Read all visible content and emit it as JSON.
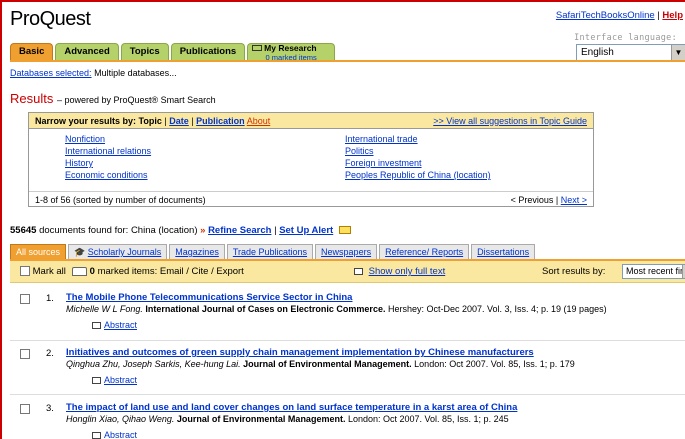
{
  "header": {
    "logo": "ProQuest",
    "link_safari": "SafariTechBooksOnline",
    "link_sep": "|",
    "link_help": "Help",
    "interface_label": "Interface language:",
    "language": "English"
  },
  "tabs": [
    {
      "label": "Basic"
    },
    {
      "label": "Advanced"
    },
    {
      "label": "Topics"
    },
    {
      "label": "Publications"
    }
  ],
  "research_tab": {
    "label": "My Research",
    "sub": "0 marked items"
  },
  "databases": {
    "label": "Databases selected:",
    "value": "Multiple databases..."
  },
  "results_title": {
    "title": "Results",
    "powered": "– powered by ProQuest® Smart Search"
  },
  "narrow": {
    "label": "Narrow your results by:",
    "topic": "Topic",
    "sep1": "|",
    "date": "Date",
    "sep2": "|",
    "publication": "Publication",
    "about": "About",
    "view_all": ">> View all suggestions in Topic Guide",
    "col1": [
      "Nonfiction",
      "International relations",
      "History",
      "Economic conditions"
    ],
    "col2": [
      "International trade",
      "Politics",
      "Foreign investment",
      "Peoples Republic of China (location)"
    ],
    "range": "1-8 of 56 (sorted by number of documents)",
    "previous": "< Previous",
    "pg_sep": "|",
    "next": "Next >"
  },
  "count": {
    "number": "55645",
    "text": "documents found for: China (location)",
    "arrows": "»",
    "refine": "Refine Search",
    "sep": "|",
    "alert": "Set Up Alert"
  },
  "source_tabs": [
    "All sources",
    "Scholarly Journals",
    "Magazines",
    "Trade Publications",
    "Newspapers",
    "Reference/ Reports",
    "Dissertations"
  ],
  "toolbar": {
    "mark_all": "Mark all",
    "marked": "0",
    "marked_text": "marked items: Email / Cite / Export",
    "full_text": "Show only full text",
    "sort_label": "Sort results by:",
    "sort_value": "Most recent first"
  },
  "results": [
    {
      "num": "1.",
      "title": "The Mobile Phone Telecommunications Service Sector in China",
      "authors": "Michelle W L Fong.",
      "journal": "International Journal of Cases on Electronic Commerce.",
      "details": "Hershey: Oct-Dec 2007. Vol. 3, Iss. 4; p. 19 (19 pages)",
      "abstract": "Abstract"
    },
    {
      "num": "2.",
      "title": "Initiatives and outcomes of green supply chain management implementation by Chinese manufacturers",
      "authors": "Qinghua Zhu, Joseph Sarkis, Kee-hung Lai.",
      "journal": "Journal of Environmental Management.",
      "details": "London: Oct 2007. Vol. 85, Iss. 1; p. 179",
      "abstract": "Abstract"
    },
    {
      "num": "3.",
      "title": "The impact of land use and land cover changes on land surface temperature in a karst area of China",
      "authors": "Honglin Xiao, Qihao Weng.",
      "journal": "Journal of Environmental Management.",
      "details": "London: Oct 2007. Vol. 85, Iss. 1; p. 245",
      "abstract": "Abstract"
    }
  ]
}
